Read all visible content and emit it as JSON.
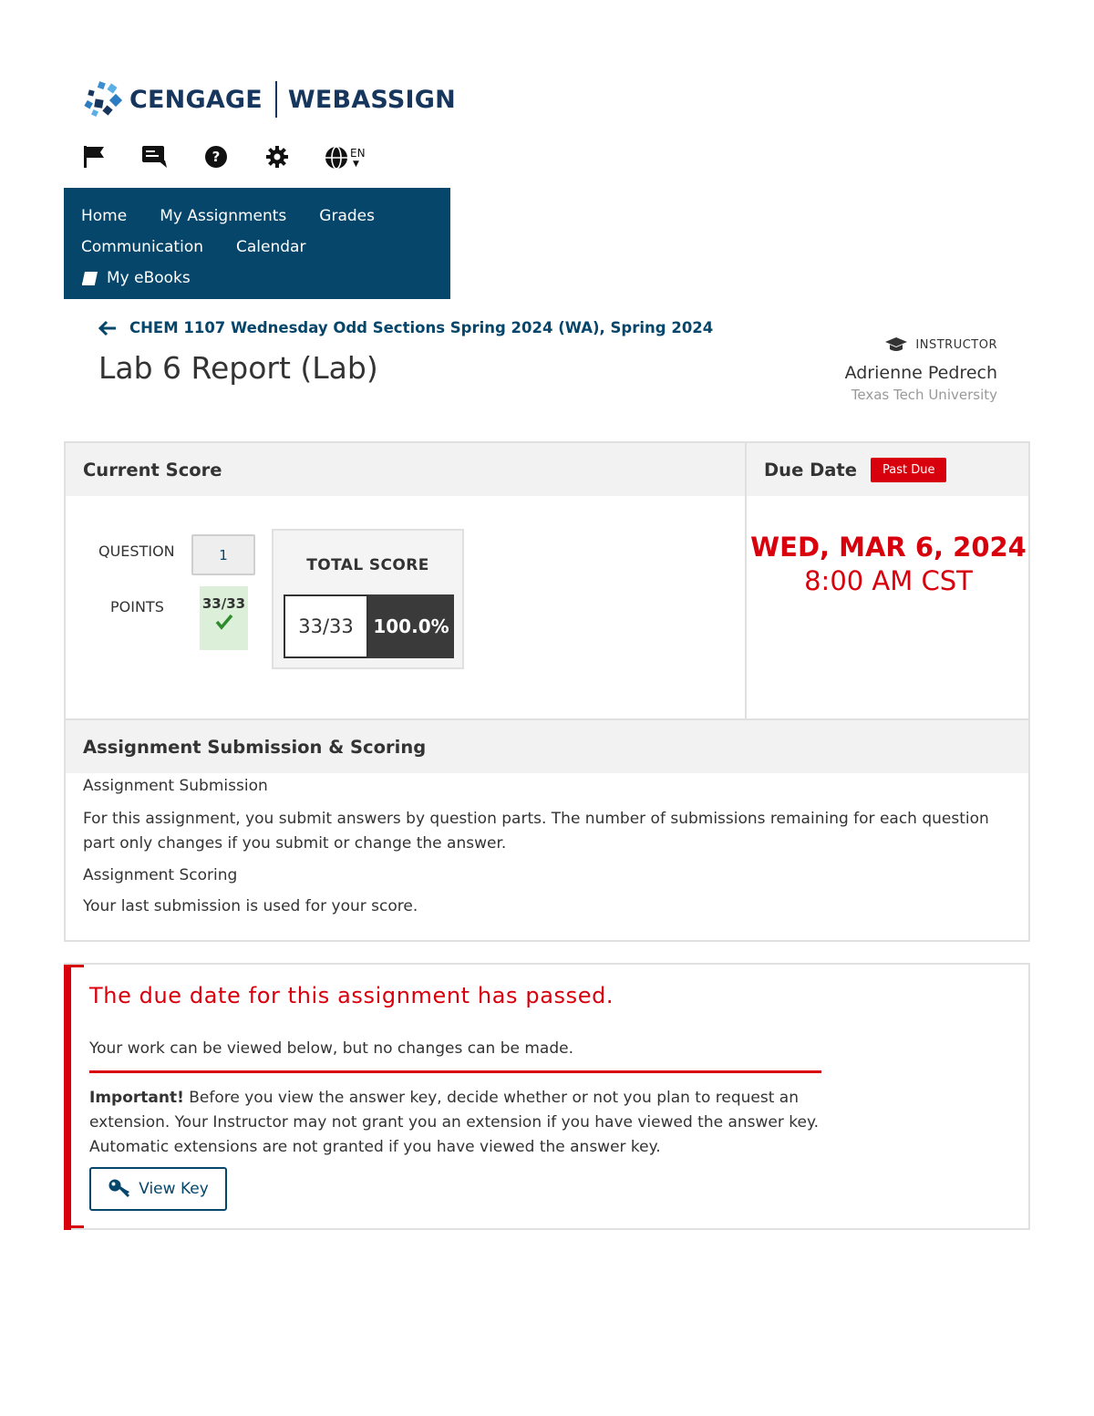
{
  "brand": {
    "name_left": "CENGAGE",
    "name_right": "WEBASSIGN"
  },
  "toolbar": {
    "icons": [
      "flag-icon",
      "chat-icon",
      "help-icon",
      "settings-icon",
      "globe-icon"
    ],
    "language": "EN"
  },
  "nav": {
    "items": [
      {
        "label": "Home"
      },
      {
        "label": "My Assignments"
      },
      {
        "label": "Grades"
      },
      {
        "label": "Communication"
      },
      {
        "label": "Calendar"
      },
      {
        "label": "My eBooks"
      }
    ]
  },
  "breadcrumb": {
    "course": "CHEM 1107 Wednesday Odd Sections Spring 2024 (WA), Spring 2024"
  },
  "assignment": {
    "title": "Lab 6 Report (Lab)"
  },
  "instructor": {
    "role": "INSTRUCTOR",
    "name": "Adrienne Pedrech",
    "school": "Texas Tech University"
  },
  "score": {
    "heading": "Current Score",
    "question_label": "QUESTION",
    "points_label": "POINTS",
    "question_number": "1",
    "question_points": "33/33",
    "total_label": "TOTAL SCORE",
    "total_fraction": "33/33",
    "total_percent": "100.0%"
  },
  "due": {
    "heading": "Due Date",
    "badge": "Past Due",
    "date": "WED, MAR 6, 2024",
    "time": "8:00 AM CST"
  },
  "submission": {
    "heading": "Assignment Submission & Scoring",
    "sub_heading": "Assignment Submission",
    "sub_text": "For this assignment, you submit answers by question parts. The number of submissions remaining for each question part only changes if you submit or change the answer.",
    "scoring_heading": "Assignment Scoring",
    "scoring_text": "Your last submission is used for your score."
  },
  "alert": {
    "title": "The due date for this assignment has passed.",
    "subtitle": "Your work can be viewed below, but no changes can be made.",
    "important_label": "Important!",
    "important_text": " Before you view the answer key, decide whether or not you plan to request an extension. Your Instructor may not grant you an extension if you have viewed the answer key. Automatic extensions are not granted if you have viewed the answer key.",
    "button_label": "View Key"
  },
  "colors": {
    "brand_navy": "#17365e",
    "nav_bg": "#06466b",
    "alert_red": "#d9000d",
    "points_green_bg": "#dcefd9",
    "check_green": "#2e8b2e"
  }
}
